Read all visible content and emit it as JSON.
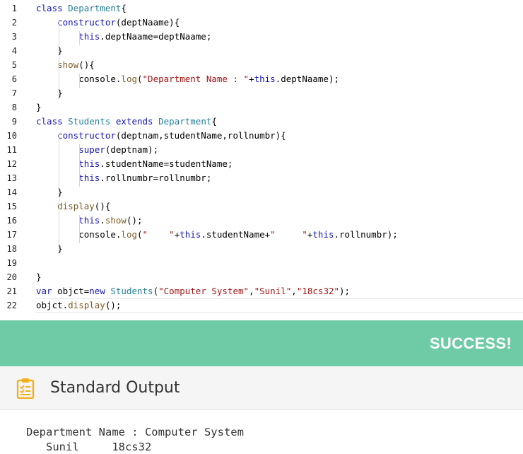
{
  "editor": {
    "line_numbers": [
      "1",
      "2",
      "3",
      "4",
      "5",
      "6",
      "7",
      "8",
      "9",
      "10",
      "11",
      "12",
      "13",
      "14",
      "15",
      "16",
      "17",
      "18",
      "19",
      "20",
      "21",
      "22"
    ],
    "lines": [
      [
        {
          "t": "class ",
          "c": "kw"
        },
        {
          "t": "Department",
          "c": "cls"
        },
        {
          "t": "{",
          "c": "pl"
        }
      ],
      [
        {
          "t": "    constructor",
          "c": "kw"
        },
        {
          "t": "(deptNaame){",
          "c": "pl"
        }
      ],
      [
        {
          "t": "        this",
          "c": "kw"
        },
        {
          "t": ".deptNaame=deptNaame;",
          "c": "pl"
        }
      ],
      [
        {
          "t": "    }",
          "c": "pl"
        }
      ],
      [
        {
          "t": "    show",
          "c": "fn"
        },
        {
          "t": "(){",
          "c": "pl"
        }
      ],
      [
        {
          "t": "        console",
          "c": "pl"
        },
        {
          "t": ".",
          "c": "pl"
        },
        {
          "t": "log",
          "c": "fn"
        },
        {
          "t": "(",
          "c": "pl"
        },
        {
          "t": "\"Department Name : \"",
          "c": "str"
        },
        {
          "t": "+",
          "c": "pl"
        },
        {
          "t": "this",
          "c": "kw"
        },
        {
          "t": ".deptNaame);",
          "c": "pl"
        }
      ],
      [
        {
          "t": "    }",
          "c": "pl"
        }
      ],
      [
        {
          "t": "}",
          "c": "pl"
        }
      ],
      [
        {
          "t": "class ",
          "c": "kw"
        },
        {
          "t": "Students ",
          "c": "cls"
        },
        {
          "t": "extends ",
          "c": "kw"
        },
        {
          "t": "Department",
          "c": "cls"
        },
        {
          "t": "{",
          "c": "pl"
        }
      ],
      [
        {
          "t": "    constructor",
          "c": "kw"
        },
        {
          "t": "(deptnam,studentName,rollnumbr){",
          "c": "pl"
        }
      ],
      [
        {
          "t": "        super",
          "c": "kw"
        },
        {
          "t": "(deptnam);",
          "c": "pl"
        }
      ],
      [
        {
          "t": "        this",
          "c": "kw"
        },
        {
          "t": ".studentName=studentName;",
          "c": "pl"
        }
      ],
      [
        {
          "t": "        this",
          "c": "kw"
        },
        {
          "t": ".rollnumbr=rollnumbr;",
          "c": "pl"
        }
      ],
      [
        {
          "t": "    }",
          "c": "pl"
        }
      ],
      [
        {
          "t": "    display",
          "c": "fn"
        },
        {
          "t": "(){",
          "c": "pl"
        }
      ],
      [
        {
          "t": "        this",
          "c": "kw"
        },
        {
          "t": ".",
          "c": "pl"
        },
        {
          "t": "show",
          "c": "fn"
        },
        {
          "t": "();",
          "c": "pl"
        }
      ],
      [
        {
          "t": "        console",
          "c": "pl"
        },
        {
          "t": ".",
          "c": "pl"
        },
        {
          "t": "log",
          "c": "fn"
        },
        {
          "t": "(",
          "c": "pl"
        },
        {
          "t": "\"    \"",
          "c": "str"
        },
        {
          "t": "+",
          "c": "pl"
        },
        {
          "t": "this",
          "c": "kw"
        },
        {
          "t": ".studentName+",
          "c": "pl"
        },
        {
          "t": "\"     \"",
          "c": "str"
        },
        {
          "t": "+",
          "c": "pl"
        },
        {
          "t": "this",
          "c": "kw"
        },
        {
          "t": ".rollnumbr);",
          "c": "pl"
        }
      ],
      [
        {
          "t": "    }",
          "c": "pl"
        }
      ],
      [],
      [
        {
          "t": "}",
          "c": "pl"
        }
      ],
      [
        {
          "t": "var ",
          "c": "kw"
        },
        {
          "t": "objct=",
          "c": "pl"
        },
        {
          "t": "new ",
          "c": "kw"
        },
        {
          "t": "Students",
          "c": "cls"
        },
        {
          "t": "(",
          "c": "pl"
        },
        {
          "t": "\"Computer System\"",
          "c": "str"
        },
        {
          "t": ",",
          "c": "pl"
        },
        {
          "t": "\"Sunil\"",
          "c": "str"
        },
        {
          "t": ",",
          "c": "pl"
        },
        {
          "t": "\"18cs32\"",
          "c": "str"
        },
        {
          "t": ");",
          "c": "pl"
        }
      ],
      [
        {
          "t": "objct.",
          "c": "pl"
        },
        {
          "t": "display",
          "c": "fn"
        },
        {
          "t": "();",
          "c": "pl"
        }
      ]
    ],
    "active_line": 22
  },
  "result": {
    "status_text": "SUCCESS!",
    "status_color": "#6ecba5"
  },
  "output_panel": {
    "icon": "clipboard-icon",
    "title": "Standard Output",
    "lines": [
      "Department Name : Computer System",
      "   Sunil     18cs32"
    ]
  }
}
